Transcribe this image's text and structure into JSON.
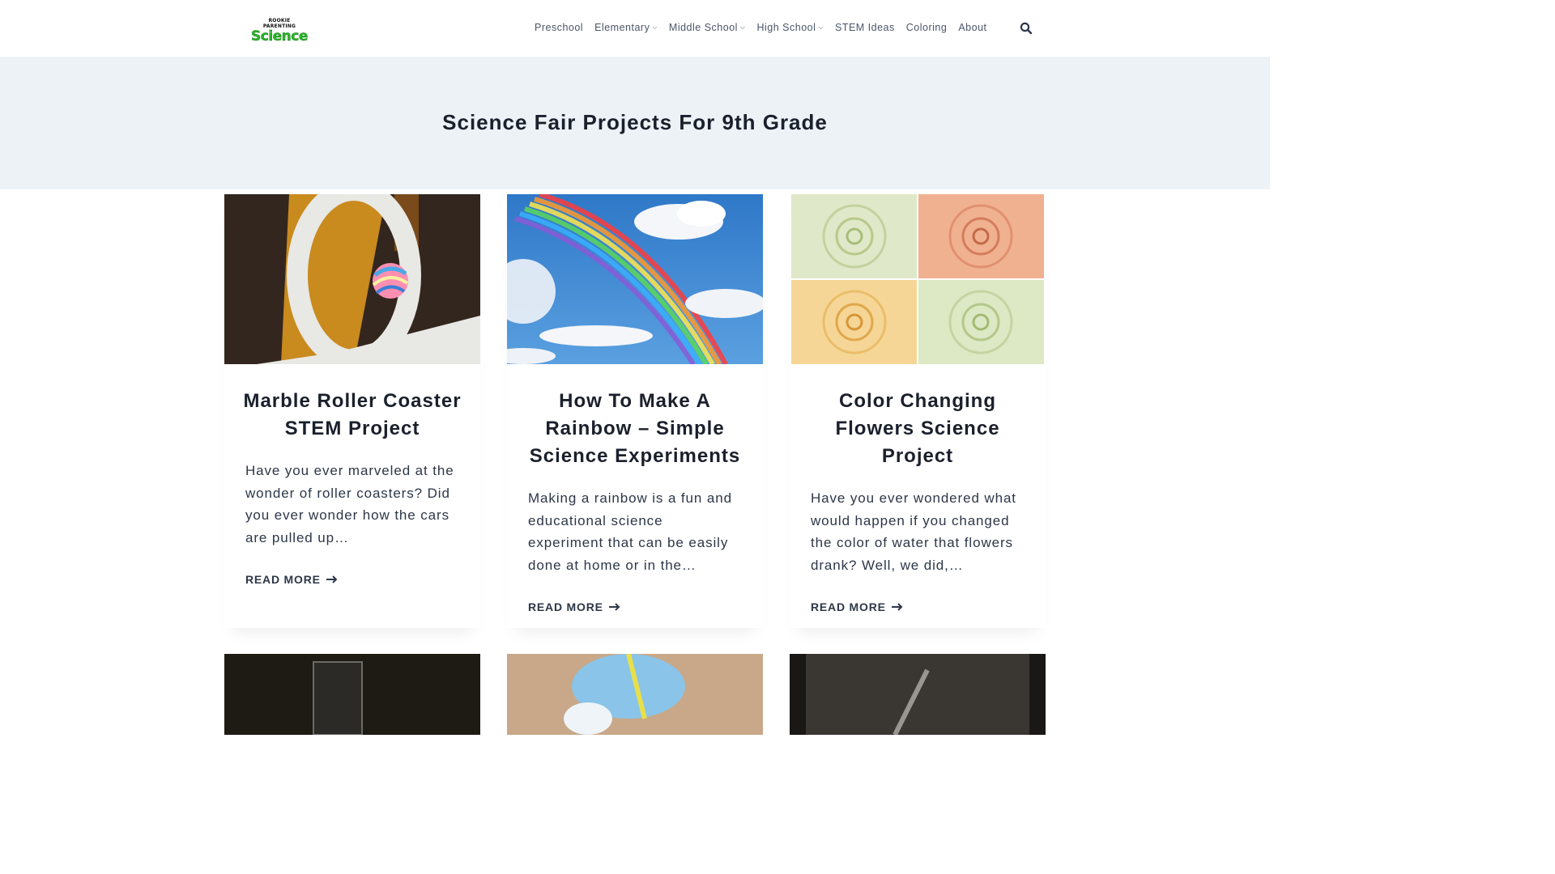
{
  "logo": {
    "top": "ROOKIE PARENTING",
    "main": "Science"
  },
  "nav": {
    "items": [
      {
        "label": "Preschool",
        "dropdown": false
      },
      {
        "label": "Elementary",
        "dropdown": true
      },
      {
        "label": "Middle School",
        "dropdown": true
      },
      {
        "label": "High School",
        "dropdown": true
      },
      {
        "label": "STEM Ideas",
        "dropdown": false
      },
      {
        "label": "Coloring",
        "dropdown": false
      },
      {
        "label": "About",
        "dropdown": false
      }
    ],
    "search_icon": "search-icon"
  },
  "hero": {
    "title": "Science Fair Projects For 9th Grade"
  },
  "cards": [
    {
      "title": "Marble Roller Coaster STEM Project",
      "excerpt": "Have you ever marveled at the wonder of roller coasters? Did you ever wonder how the cars are pulled up…",
      "read_more": "READ MORE",
      "image": "marble roller coaster"
    },
    {
      "title": "How To Make A Rainbow – Simple Science Experiments",
      "excerpt": "Making a rainbow is a fun and educational science experiment that can be easily done at home or in the…",
      "read_more": "READ MORE",
      "image": "rainbow in sky"
    },
    {
      "title": "Color Changing Flowers Science Project",
      "excerpt": "Have you ever wondered what would happen if you changed the color of water that flowers drank? Well, we did,…",
      "read_more": "READ MORE",
      "image": "colored roses"
    }
  ],
  "colors": {
    "hero_bg": "#edf2f7",
    "text": "#1a202c",
    "logo_green": "#2bb32b"
  }
}
